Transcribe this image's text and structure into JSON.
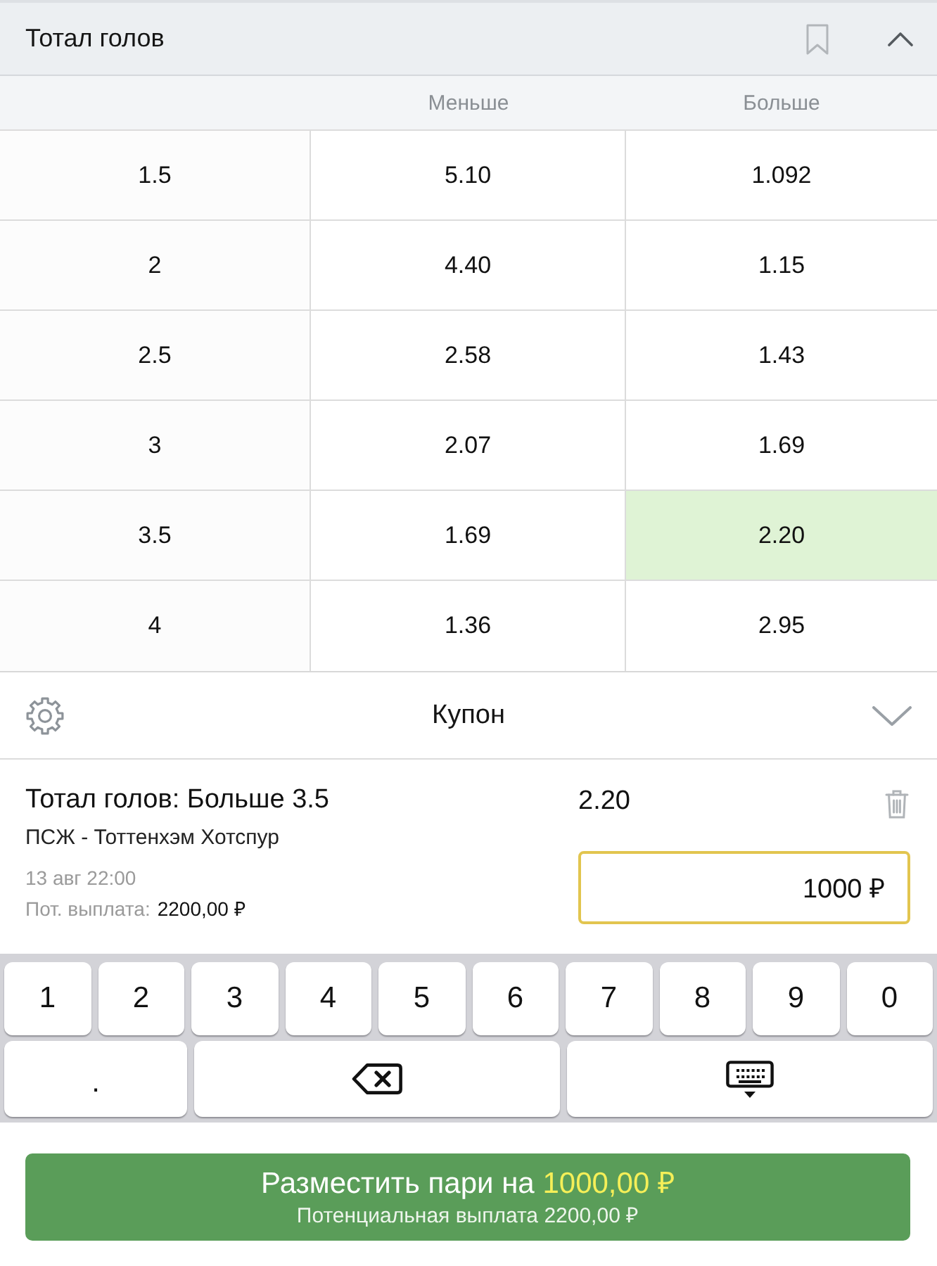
{
  "market": {
    "title": "Тотал голов",
    "bookmarked": false,
    "expanded": true
  },
  "odds_table": {
    "columns": [
      "Меньше",
      "Больше"
    ],
    "rows": [
      {
        "total": "1.5",
        "under": {
          "odds": "5.10",
          "selected": false
        },
        "over": {
          "odds": "1.092",
          "selected": false
        }
      },
      {
        "total": "2",
        "under": {
          "odds": "4.40",
          "selected": false
        },
        "over": {
          "odds": "1.15",
          "selected": false
        }
      },
      {
        "total": "2.5",
        "under": {
          "odds": "2.58",
          "selected": false
        },
        "over": {
          "odds": "1.43",
          "selected": false
        }
      },
      {
        "total": "3",
        "under": {
          "odds": "2.07",
          "selected": false
        },
        "over": {
          "odds": "1.69",
          "selected": false
        }
      },
      {
        "total": "3.5",
        "under": {
          "odds": "1.69",
          "selected": false
        },
        "over": {
          "odds": "2.20",
          "selected": true
        }
      },
      {
        "total": "4",
        "under": {
          "odds": "1.36",
          "selected": false
        },
        "over": {
          "odds": "2.95",
          "selected": false
        }
      }
    ]
  },
  "coupon": {
    "title": "Купон",
    "expanded": true,
    "bet": {
      "market": "Тотал голов: Больше 3.5",
      "match": "ПСЖ - Тоттенхэм Хотспур",
      "datetime": "13 авг 22:00",
      "payout_label": "Пот. выплата:",
      "payout": "2200,00 ₽",
      "odds": "2.20",
      "stake": {
        "value": "1000 ₽",
        "focused": true
      }
    }
  },
  "keypad": {
    "rows": [
      [
        {
          "kind": "char",
          "label": "1"
        },
        {
          "kind": "char",
          "label": "2"
        },
        {
          "kind": "char",
          "label": "3"
        },
        {
          "kind": "char",
          "label": "4"
        },
        {
          "kind": "char",
          "label": "5"
        },
        {
          "kind": "char",
          "label": "6"
        },
        {
          "kind": "char",
          "label": "7"
        },
        {
          "kind": "char",
          "label": "8"
        },
        {
          "kind": "char",
          "label": "9"
        },
        {
          "kind": "char",
          "label": "0"
        }
      ],
      [
        {
          "kind": "char",
          "label": "."
        },
        {
          "kind": "backspace"
        },
        {
          "kind": "hide"
        }
      ]
    ]
  },
  "place_bet": {
    "label": "Разместить пари на",
    "amount": "1000,00 ₽",
    "potential": "Потенциальная выплата 2200,00 ₽"
  }
}
